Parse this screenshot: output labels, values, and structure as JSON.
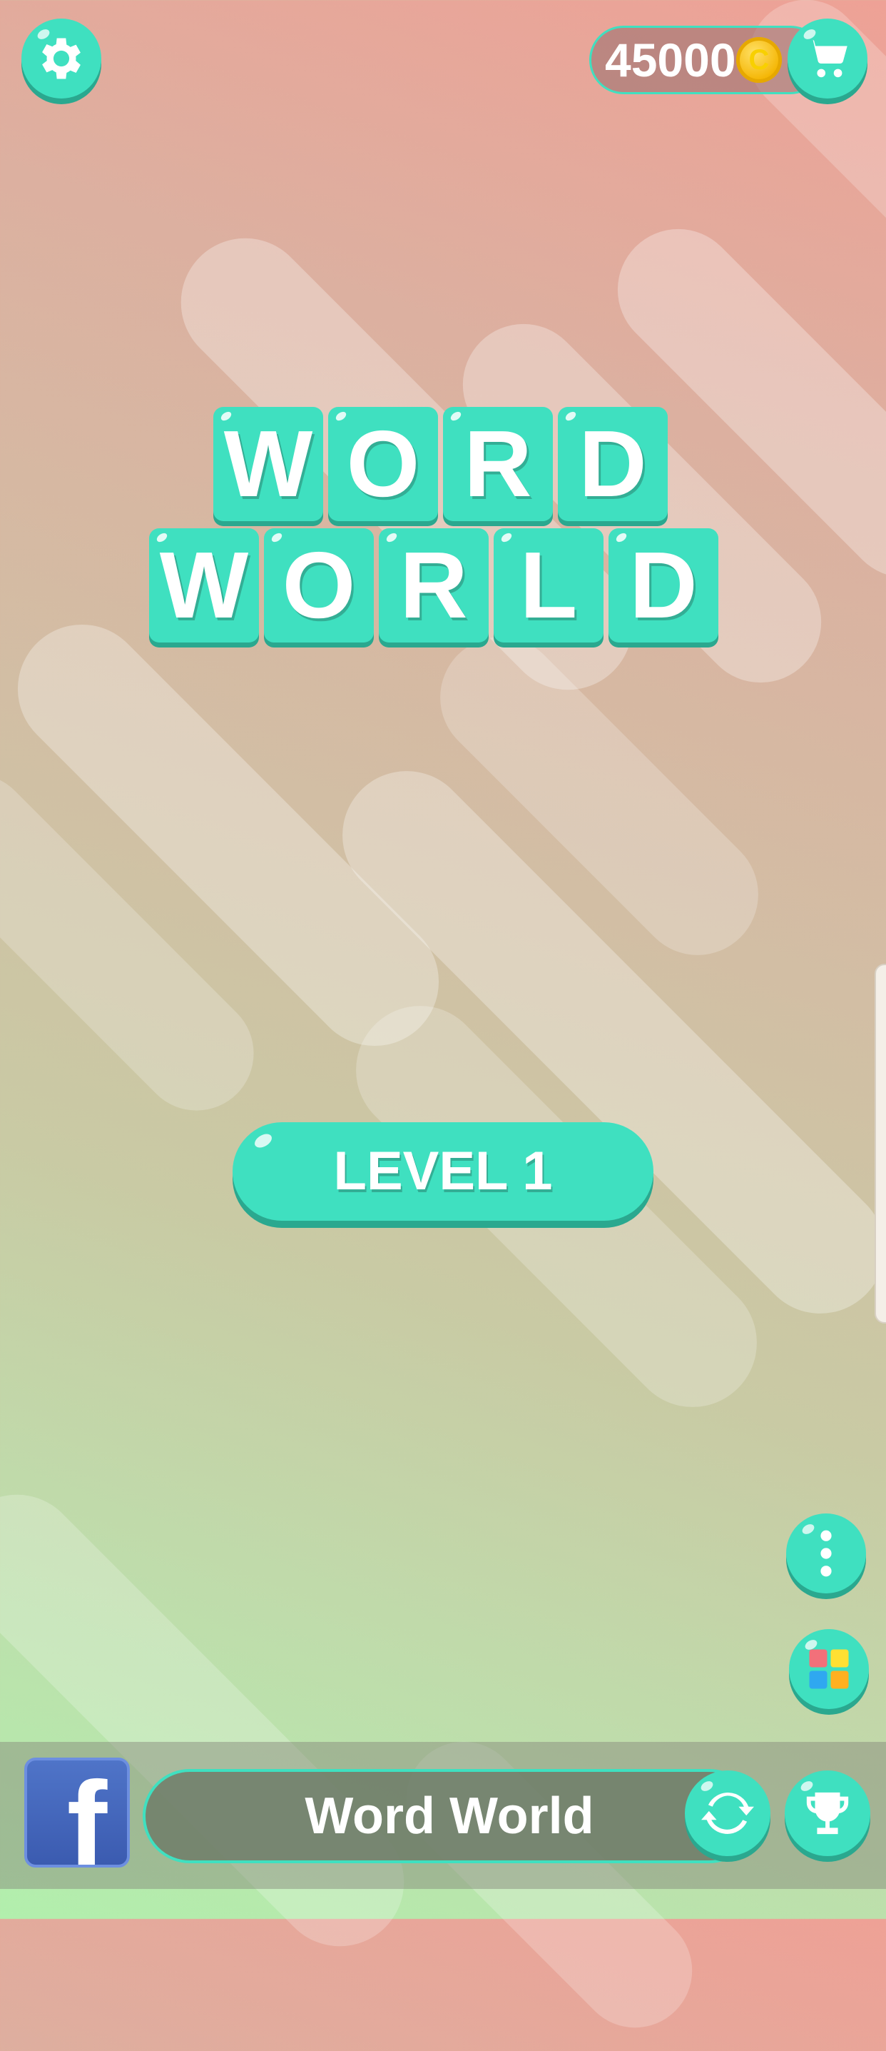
{
  "header": {
    "coins": "45000",
    "coin_symbol": "C",
    "settings_icon": "gear-icon",
    "shop_icon": "cart-icon"
  },
  "logo": {
    "row1": [
      "W",
      "O",
      "R",
      "D"
    ],
    "row2": [
      "W",
      "O",
      "R",
      "L",
      "D"
    ]
  },
  "play": {
    "level_label": "LEVEL 1"
  },
  "side_buttons": {
    "more_icon": "more-vertical-icon",
    "apps_icon": "apps-grid-icon"
  },
  "bottom_bar": {
    "facebook_glyph": "f",
    "title": "Word World",
    "refresh_icon": "refresh-icon",
    "leaderboard_icon": "trophy-icon"
  },
  "colors": {
    "accent": "#3fe0c0",
    "accent_shadow": "#2aa88f",
    "coin": "#f4b400",
    "facebook": "#3b5bb0",
    "apps_red": "#f2707a",
    "apps_yellow": "#ffe033",
    "apps_blue": "#2fa8f0",
    "apps_orange": "#ffb020"
  }
}
